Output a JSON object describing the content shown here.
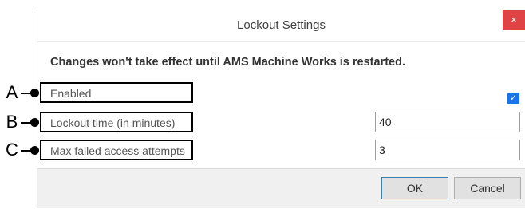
{
  "dialog": {
    "title": "Lockout Settings",
    "close_glyph": "×",
    "notice": "Changes won't take effect until AMS Machine Works is restarted."
  },
  "settings": {
    "enabled_label": "Enabled",
    "enabled_checked": true,
    "checkbox_glyph": "✓",
    "lockout_label": "Lockout time (in minutes)",
    "lockout_value": "40",
    "attempts_label": "Max failed access attempts",
    "attempts_value": "3"
  },
  "footer": {
    "ok_label": "OK",
    "cancel_label": "Cancel"
  },
  "callouts": {
    "a": "A",
    "b": "B",
    "c": "C"
  },
  "colors": {
    "close_button": "#e04343",
    "checkbox": "#1a73e8",
    "footer_bg": "#f0f0f0"
  }
}
